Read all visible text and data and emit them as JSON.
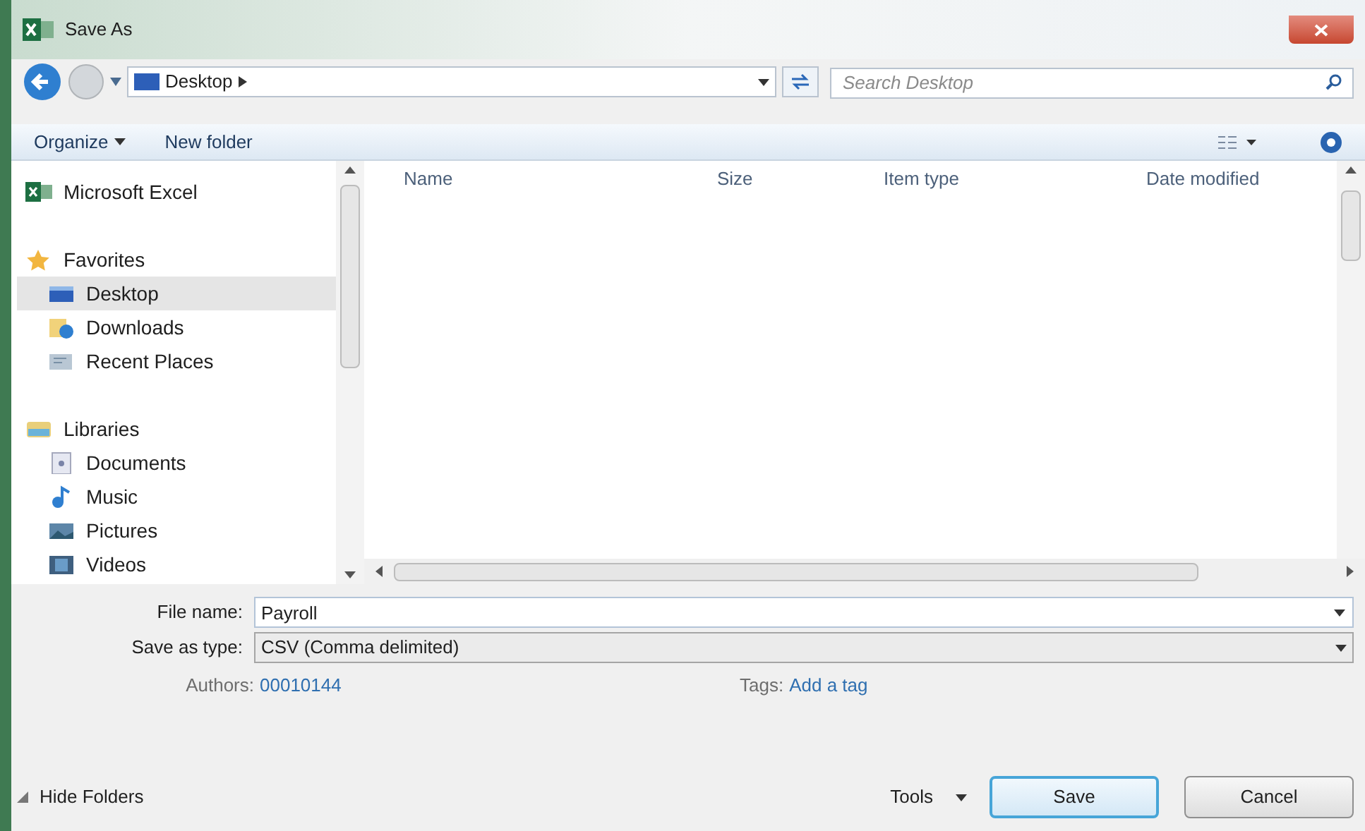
{
  "window": {
    "title": "Save As"
  },
  "address": {
    "path": "Desktop",
    "search_placeholder": "Search Desktop"
  },
  "toolbar": {
    "organize": "Organize",
    "new_folder": "New folder"
  },
  "sidebar": {
    "items": [
      {
        "label": "Microsoft Excel",
        "kind": "excel",
        "selected": false
      },
      {
        "label": "Favorites",
        "kind": "star",
        "selected": false,
        "children": [
          {
            "label": "Desktop",
            "kind": "desktop",
            "selected": true
          },
          {
            "label": "Downloads",
            "kind": "downloads",
            "selected": false
          },
          {
            "label": "Recent Places",
            "kind": "recent",
            "selected": false
          }
        ]
      },
      {
        "label": "Libraries",
        "kind": "libraries",
        "selected": false,
        "children": [
          {
            "label": "Documents",
            "kind": "documents",
            "selected": false
          },
          {
            "label": "Music",
            "kind": "music",
            "selected": false
          },
          {
            "label": "Pictures",
            "kind": "pictures",
            "selected": false
          },
          {
            "label": "Videos",
            "kind": "videos",
            "selected": false
          }
        ]
      }
    ]
  },
  "table": {
    "columns": [
      "Name",
      "Size",
      "Item type",
      "Date modified"
    ]
  },
  "form": {
    "file_name_label": "File name:",
    "file_name": "Payroll",
    "type_label": "Save as type:",
    "type": "CSV (Comma delimited)",
    "authors_label": "Authors:",
    "authors": "00010144",
    "tags_label": "Tags:",
    "tags": "Add a tag"
  },
  "footer": {
    "hide_folders": "Hide Folders",
    "tools": "Tools",
    "save": "Save",
    "cancel": "Cancel"
  }
}
